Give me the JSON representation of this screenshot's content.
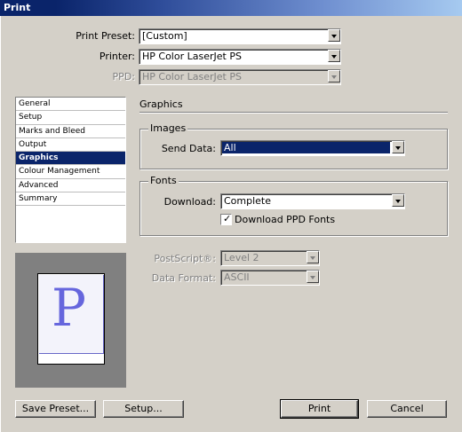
{
  "window": {
    "title": "Print"
  },
  "top": {
    "print_preset": {
      "label": "Print Preset:",
      "value": "[Custom]"
    },
    "printer": {
      "label": "Printer:",
      "value": "HP Color LaserJet PS"
    },
    "ppd": {
      "label": "PPD:",
      "value": "HP Color LaserJet PS"
    }
  },
  "sidebar": {
    "items": [
      {
        "label": "General"
      },
      {
        "label": "Setup"
      },
      {
        "label": "Marks and Bleed"
      },
      {
        "label": "Output"
      },
      {
        "label": "Graphics",
        "selected": true
      },
      {
        "label": "Colour Management"
      },
      {
        "label": "Advanced"
      },
      {
        "label": "Summary"
      }
    ]
  },
  "preview": {
    "letter": "P"
  },
  "graphics": {
    "section_title": "Graphics",
    "images": {
      "legend": "Images",
      "send_data_label": "Send Data:",
      "send_data_value": "All"
    },
    "fonts": {
      "legend": "Fonts",
      "download_label": "Download:",
      "download_value": "Complete",
      "download_ppd_fonts_label": "Download PPD Fonts",
      "download_ppd_fonts_checked": true
    },
    "postscript_label": "PostScript®:",
    "postscript_value": "Level 2",
    "data_format_label": "Data Format:",
    "data_format_value": "ASCII"
  },
  "buttons": {
    "save_preset": "Save Preset...",
    "setup": "Setup...",
    "print": "Print",
    "cancel": "Cancel"
  }
}
